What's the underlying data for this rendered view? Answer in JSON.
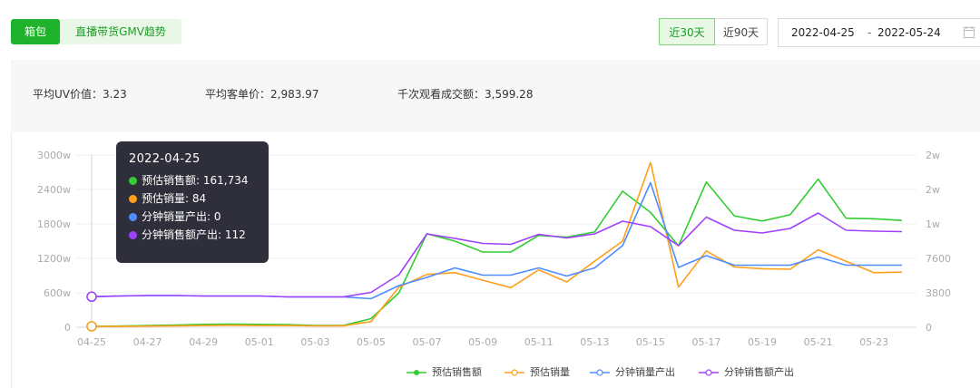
{
  "header": {
    "active_tab": "箱包",
    "title": "直播带货GMV趋势",
    "range_options": [
      "近30天",
      "近90天"
    ],
    "selected_range": "近30天",
    "date_start": "2022-04-25",
    "date_sep": "-",
    "date_end": "2022-05-24"
  },
  "stats": [
    {
      "label": "平均UV价值：",
      "value": "3.23"
    },
    {
      "label": "平均客单价：",
      "value": "2,983.97"
    },
    {
      "label": "千次观看成交额：",
      "value": "3,599.28"
    }
  ],
  "tooltip": {
    "date": "2022-04-25",
    "rows": [
      {
        "label": "预估销售额",
        "value": "161,734",
        "color": "#33cc33"
      },
      {
        "label": "预估销量",
        "value": "84",
        "color": "#ff9f1a"
      },
      {
        "label": "分钟销量产出",
        "value": "0",
        "color": "#4f8dff"
      },
      {
        "label": "分钟销售额产出",
        "value": "112",
        "color": "#a040ff"
      }
    ]
  },
  "chart_data": {
    "type": "line",
    "x": [
      "04-25",
      "04-26",
      "04-27",
      "04-28",
      "04-29",
      "04-30",
      "05-01",
      "05-02",
      "05-03",
      "05-04",
      "05-05",
      "05-06",
      "05-07",
      "05-08",
      "05-09",
      "05-10",
      "05-11",
      "05-12",
      "05-13",
      "05-14",
      "05-15",
      "05-16",
      "05-17",
      "05-18",
      "05-19",
      "05-20",
      "05-21",
      "05-22",
      "05-23",
      "05-24"
    ],
    "x_tick_labels": [
      "04-25",
      "04-27",
      "04-29",
      "05-01",
      "05-03",
      "05-05",
      "05-07",
      "05-09",
      "05-11",
      "05-13",
      "05-15",
      "05-17",
      "05-19",
      "05-21",
      "05-23"
    ],
    "y_left_ticks": [
      "0",
      "600w",
      "1200w",
      "1800w",
      "2400w",
      "3000w"
    ],
    "y_left_range": [
      0,
      3000
    ],
    "y_right_ticks": [
      "0",
      "3800",
      "7600",
      "1w",
      "2w",
      "2w"
    ],
    "y_right_range": [
      0,
      19000
    ],
    "grid": true,
    "legend_position": "bottom",
    "series": [
      {
        "name": "预估销售额",
        "color": "#33cc33",
        "axis": "left",
        "values": [
          16,
          20,
          30,
          40,
          50,
          55,
          50,
          45,
          30,
          30,
          150,
          600,
          1630,
          1500,
          1310,
          1310,
          1600,
          1570,
          1660,
          2370,
          2000,
          1420,
          2530,
          1940,
          1850,
          1960,
          2580,
          1900,
          1890,
          1860
        ]
      },
      {
        "name": "预估销量",
        "color": "#ff9f1a",
        "axis": "left",
        "values": [
          16,
          15,
          20,
          25,
          30,
          35,
          30,
          30,
          25,
          25,
          100,
          700,
          920,
          950,
          820,
          690,
          1000,
          790,
          1150,
          1500,
          2870,
          700,
          1330,
          1050,
          1020,
          1010,
          1350,
          1150,
          950,
          960
        ]
      },
      {
        "name": "分钟销量产出",
        "color": "#4f8dff",
        "axis": "right",
        "values": [
          3370,
          3450,
          3500,
          3500,
          3450,
          3450,
          3450,
          3350,
          3350,
          3350,
          3150,
          4600,
          5500,
          6550,
          5750,
          5750,
          6550,
          5650,
          6550,
          9000,
          15950,
          6600,
          7900,
          6850,
          6850,
          6850,
          7750,
          6850,
          6850,
          6850
        ]
      },
      {
        "name": "分钟销售额产出",
        "color": "#a040ff",
        "axis": "right",
        "values": [
          3370,
          3450,
          3500,
          3500,
          3450,
          3450,
          3450,
          3350,
          3350,
          3350,
          3850,
          5800,
          10300,
          9800,
          9250,
          9150,
          10250,
          9850,
          10300,
          11700,
          11100,
          9000,
          12150,
          10700,
          10400,
          10900,
          12600,
          10700,
          10600,
          10550
        ]
      }
    ]
  }
}
